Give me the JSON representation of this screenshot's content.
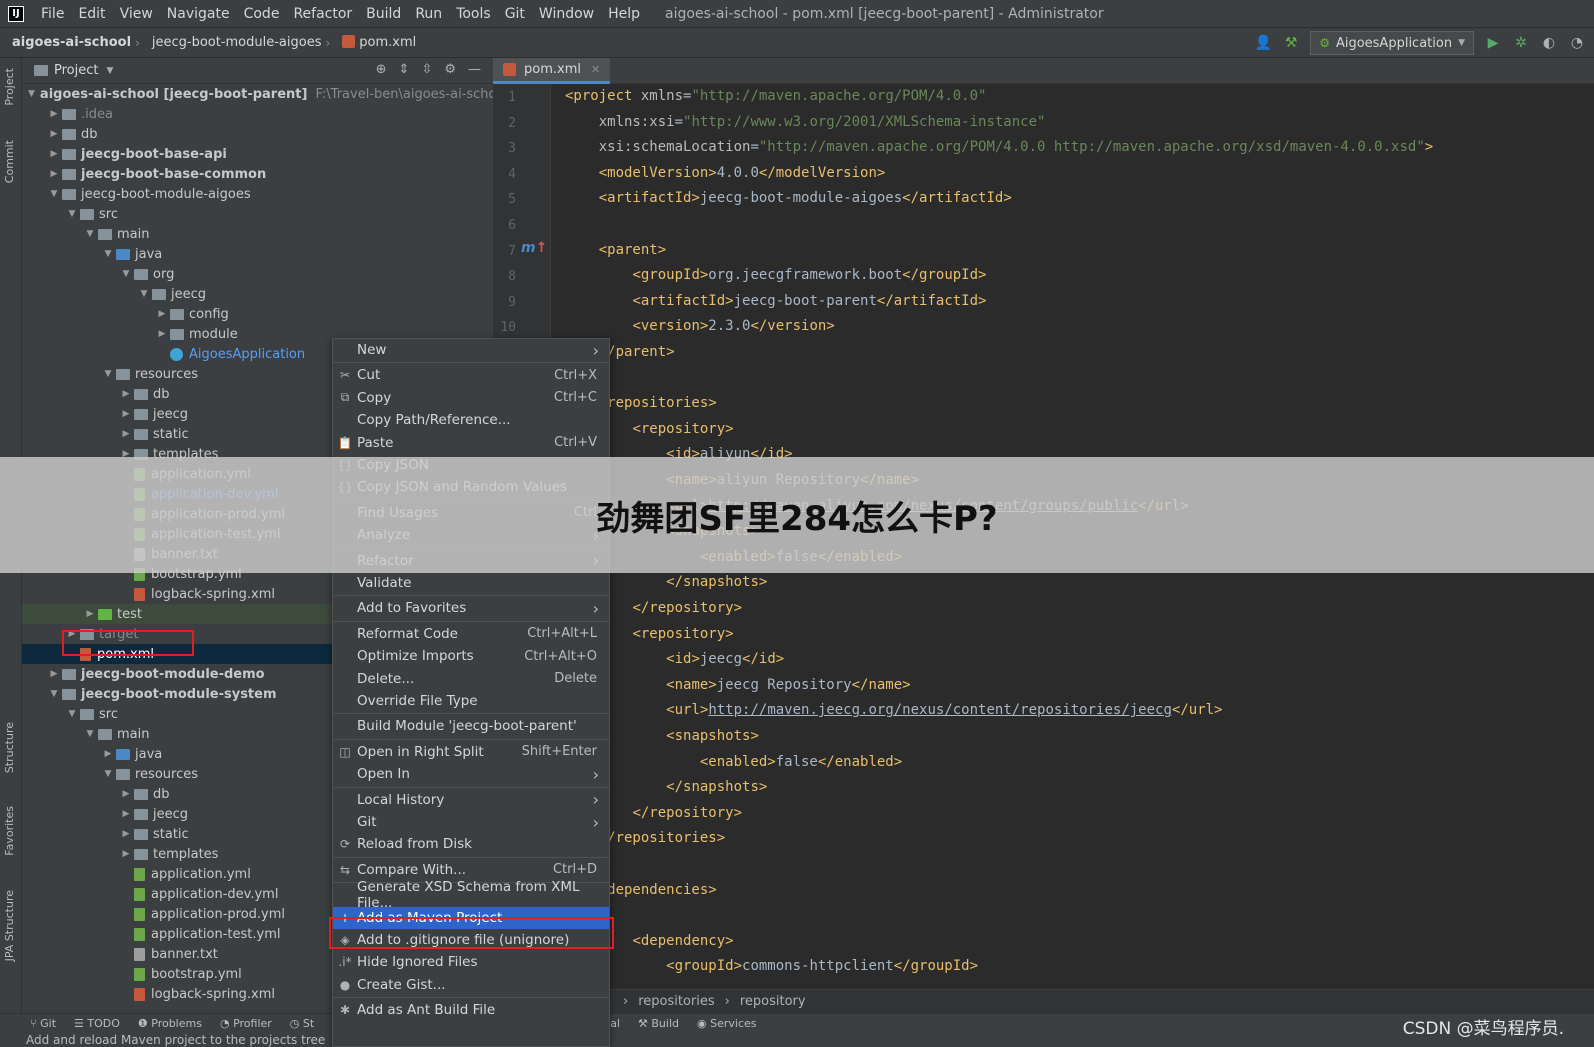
{
  "menubar": {
    "logo": "IJ",
    "items": [
      "File",
      "Edit",
      "View",
      "Navigate",
      "Code",
      "Refactor",
      "Build",
      "Run",
      "Tools",
      "Git",
      "Window",
      "Help"
    ],
    "window_title": "aigoes-ai-school - pom.xml [jeecg-boot-parent] - Administrator"
  },
  "navbar": {
    "crumbs": [
      "aigoes-ai-school",
      "jeecg-boot-module-aigoes",
      "pom.xml"
    ],
    "run_config": "AigoesApplication"
  },
  "left_strip": [
    "Project",
    "Commit",
    "Structure",
    "Favorites",
    "JPA Structure"
  ],
  "project_panel": {
    "title": "Project",
    "tree": [
      {
        "label": "aigoes-ai-school [jeecg-boot-parent]",
        "hint": "F:\\Travel-ben\\aigoes-ai-school",
        "depth": 0,
        "arrow": "open",
        "icon": "module",
        "style": "bold-root"
      },
      {
        "label": ".idea",
        "depth": 1,
        "arrow": "closed",
        "icon": "folder",
        "style": "grey"
      },
      {
        "label": "db",
        "depth": 1,
        "arrow": "closed",
        "icon": "folder",
        "style": ""
      },
      {
        "label": "jeecg-boot-base-api",
        "depth": 1,
        "arrow": "closed",
        "icon": "module",
        "style": "bold"
      },
      {
        "label": "jeecg-boot-base-common",
        "depth": 1,
        "arrow": "closed",
        "icon": "module",
        "style": "bold"
      },
      {
        "label": "jeecg-boot-module-aigoes",
        "depth": 1,
        "arrow": "open",
        "icon": "module",
        "style": ""
      },
      {
        "label": "src",
        "depth": 2,
        "arrow": "open",
        "icon": "folder",
        "style": ""
      },
      {
        "label": "main",
        "depth": 3,
        "arrow": "open",
        "icon": "folder",
        "style": ""
      },
      {
        "label": "java",
        "depth": 4,
        "arrow": "open",
        "icon": "folder-blue",
        "style": ""
      },
      {
        "label": "org",
        "depth": 5,
        "arrow": "open",
        "icon": "folder",
        "style": ""
      },
      {
        "label": "jeecg",
        "depth": 6,
        "arrow": "open",
        "icon": "folder",
        "style": ""
      },
      {
        "label": "config",
        "depth": 7,
        "arrow": "closed",
        "icon": "folder",
        "style": ""
      },
      {
        "label": "module",
        "depth": 7,
        "arrow": "closed",
        "icon": "folder",
        "style": ""
      },
      {
        "label": "AigoesApplication",
        "depth": 7,
        "arrow": "none",
        "icon": "class",
        "style": "blue"
      },
      {
        "label": "resources",
        "depth": 4,
        "arrow": "open",
        "icon": "folder",
        "style": ""
      },
      {
        "label": "db",
        "depth": 5,
        "arrow": "closed",
        "icon": "folder",
        "style": ""
      },
      {
        "label": "jeecg",
        "depth": 5,
        "arrow": "closed",
        "icon": "folder",
        "style": ""
      },
      {
        "label": "static",
        "depth": 5,
        "arrow": "closed",
        "icon": "folder",
        "style": ""
      },
      {
        "label": "templates",
        "depth": 5,
        "arrow": "closed",
        "icon": "folder",
        "style": ""
      },
      {
        "label": "application.yml",
        "depth": 5,
        "arrow": "none",
        "icon": "yml",
        "style": ""
      },
      {
        "label": "application-dev.yml",
        "depth": 5,
        "arrow": "none",
        "icon": "yml",
        "style": "blue"
      },
      {
        "label": "application-prod.yml",
        "depth": 5,
        "arrow": "none",
        "icon": "yml",
        "style": ""
      },
      {
        "label": "application-test.yml",
        "depth": 5,
        "arrow": "none",
        "icon": "yml",
        "style": ""
      },
      {
        "label": "banner.txt",
        "depth": 5,
        "arrow": "none",
        "icon": "txt",
        "style": ""
      },
      {
        "label": "bootstrap.yml",
        "depth": 5,
        "arrow": "none",
        "icon": "yml",
        "style": ""
      },
      {
        "label": "logback-spring.xml",
        "depth": 5,
        "arrow": "none",
        "icon": "xml",
        "style": ""
      },
      {
        "label": "test",
        "depth": 3,
        "arrow": "closed",
        "icon": "folder-green",
        "style": "test"
      },
      {
        "label": "target",
        "depth": 2,
        "arrow": "closed",
        "icon": "folder",
        "style": "grey"
      },
      {
        "label": "pom.xml",
        "depth": 2,
        "arrow": "none",
        "icon": "xml",
        "style": "selected"
      },
      {
        "label": "jeecg-boot-module-demo",
        "depth": 1,
        "arrow": "closed",
        "icon": "module",
        "style": "bold"
      },
      {
        "label": "jeecg-boot-module-system",
        "depth": 1,
        "arrow": "open",
        "icon": "module",
        "style": "bold"
      },
      {
        "label": "src",
        "depth": 2,
        "arrow": "open",
        "icon": "folder",
        "style": ""
      },
      {
        "label": "main",
        "depth": 3,
        "arrow": "open",
        "icon": "folder",
        "style": ""
      },
      {
        "label": "java",
        "depth": 4,
        "arrow": "closed",
        "icon": "folder-blue",
        "style": ""
      },
      {
        "label": "resources",
        "depth": 4,
        "arrow": "open",
        "icon": "folder",
        "style": ""
      },
      {
        "label": "db",
        "depth": 5,
        "arrow": "closed",
        "icon": "folder",
        "style": ""
      },
      {
        "label": "jeecg",
        "depth": 5,
        "arrow": "closed",
        "icon": "folder",
        "style": ""
      },
      {
        "label": "static",
        "depth": 5,
        "arrow": "closed",
        "icon": "folder",
        "style": ""
      },
      {
        "label": "templates",
        "depth": 5,
        "arrow": "closed",
        "icon": "folder",
        "style": ""
      },
      {
        "label": "application.yml",
        "depth": 5,
        "arrow": "none",
        "icon": "yml",
        "style": ""
      },
      {
        "label": "application-dev.yml",
        "depth": 5,
        "arrow": "none",
        "icon": "yml",
        "style": ""
      },
      {
        "label": "application-prod.yml",
        "depth": 5,
        "arrow": "none",
        "icon": "yml",
        "style": ""
      },
      {
        "label": "application-test.yml",
        "depth": 5,
        "arrow": "none",
        "icon": "yml",
        "style": ""
      },
      {
        "label": "banner.txt",
        "depth": 5,
        "arrow": "none",
        "icon": "txt",
        "style": ""
      },
      {
        "label": "bootstrap.yml",
        "depth": 5,
        "arrow": "none",
        "icon": "yml",
        "style": ""
      },
      {
        "label": "logback-spring.xml",
        "depth": 5,
        "arrow": "none",
        "icon": "xml",
        "style": ""
      }
    ]
  },
  "editor": {
    "tab": "pom.xml",
    "line_numbers": [
      "1",
      "2",
      "3",
      "4",
      "5",
      "6",
      "7",
      "8",
      "9",
      "10"
    ],
    "lines": [
      [
        [
          "tag",
          "<project "
        ],
        [
          "attr",
          "xmlns"
        ],
        [
          "txt",
          "="
        ],
        [
          "str",
          "\"http://maven.apache.org/POM/4.0.0\""
        ]
      ],
      [
        [
          "txt",
          "    "
        ],
        [
          "attr",
          "xmlns:xsi"
        ],
        [
          "txt",
          "="
        ],
        [
          "str",
          "\"http://www.w3.org/2001/XMLSchema-instance\""
        ]
      ],
      [
        [
          "txt",
          "    "
        ],
        [
          "attr",
          "xsi:schemaLocation"
        ],
        [
          "txt",
          "="
        ],
        [
          "str",
          "\"http://maven.apache.org/POM/4.0.0 http://maven.apache.org/xsd/maven-4.0.0.xsd\""
        ],
        [
          "tag",
          ">"
        ]
      ],
      [
        [
          "txt",
          "    "
        ],
        [
          "tag",
          "<modelVersion>"
        ],
        [
          "txt",
          "4.0.0"
        ],
        [
          "tag",
          "</modelVersion>"
        ]
      ],
      [
        [
          "txt",
          "    "
        ],
        [
          "tag",
          "<artifactId>"
        ],
        [
          "txt",
          "jeecg-boot-module-aigoes"
        ],
        [
          "tag",
          "</artifactId>"
        ]
      ],
      [
        [
          "txt",
          ""
        ]
      ],
      [
        [
          "txt",
          "    "
        ],
        [
          "tag",
          "<parent>"
        ]
      ],
      [
        [
          "txt",
          "        "
        ],
        [
          "tag",
          "<groupId>"
        ],
        [
          "txt",
          "org.jeecgframework.boot"
        ],
        [
          "tag",
          "</groupId>"
        ]
      ],
      [
        [
          "txt",
          "        "
        ],
        [
          "tag",
          "<artifactId>"
        ],
        [
          "txt",
          "jeecg-boot-parent"
        ],
        [
          "tag",
          "</artifactId>"
        ]
      ],
      [
        [
          "txt",
          "        "
        ],
        [
          "tag",
          "<version>"
        ],
        [
          "txt",
          "2.3.0"
        ],
        [
          "tag",
          "</version>"
        ]
      ],
      [
        [
          "txt",
          "    "
        ],
        [
          "tag",
          "</parent>"
        ]
      ],
      [
        [
          "txt",
          ""
        ]
      ],
      [
        [
          "txt",
          "    "
        ],
        [
          "tag",
          "<repositories>"
        ]
      ],
      [
        [
          "txt",
          "        "
        ],
        [
          "tag",
          "<repository>"
        ]
      ],
      [
        [
          "txt",
          "            "
        ],
        [
          "tag",
          "<id>"
        ],
        [
          "txt",
          "aliyun"
        ],
        [
          "tag",
          "</id>"
        ]
      ],
      [
        [
          "txt",
          "            "
        ],
        [
          "tag",
          "<name>"
        ],
        [
          "txt",
          "aliyun Repository"
        ],
        [
          "tag",
          "</name>"
        ]
      ],
      [
        [
          "txt",
          "            "
        ],
        [
          "tag",
          "<url>"
        ],
        [
          "url",
          "http://maven.aliyun.com/nexus/content/groups/public"
        ],
        [
          "tag",
          "</url>"
        ]
      ],
      [
        [
          "txt",
          "            "
        ],
        [
          "tag",
          "<snapshots>"
        ]
      ],
      [
        [
          "txt",
          "                "
        ],
        [
          "tag",
          "<enabled>"
        ],
        [
          "txt",
          "false"
        ],
        [
          "tag",
          "</enabled>"
        ]
      ],
      [
        [
          "txt",
          "            "
        ],
        [
          "tag",
          "</snapshots>"
        ]
      ],
      [
        [
          "txt",
          "        "
        ],
        [
          "tag",
          "</repository>"
        ]
      ],
      [
        [
          "txt",
          "        "
        ],
        [
          "tag",
          "<repository>"
        ]
      ],
      [
        [
          "txt",
          "            "
        ],
        [
          "tag",
          "<id>"
        ],
        [
          "txt",
          "jeecg"
        ],
        [
          "tag",
          "</id>"
        ]
      ],
      [
        [
          "txt",
          "            "
        ],
        [
          "tag",
          "<name>"
        ],
        [
          "txt",
          "jeecg Repository"
        ],
        [
          "tag",
          "</name>"
        ]
      ],
      [
        [
          "txt",
          "            "
        ],
        [
          "tag",
          "<url>"
        ],
        [
          "url",
          "http://maven.jeecg.org/nexus/content/repositories/jeecg"
        ],
        [
          "tag",
          "</url>"
        ]
      ],
      [
        [
          "txt",
          "            "
        ],
        [
          "tag",
          "<snapshots>"
        ]
      ],
      [
        [
          "txt",
          "                "
        ],
        [
          "tag",
          "<enabled>"
        ],
        [
          "txt",
          "false"
        ],
        [
          "tag",
          "</enabled>"
        ]
      ],
      [
        [
          "txt",
          "            "
        ],
        [
          "tag",
          "</snapshots>"
        ]
      ],
      [
        [
          "txt",
          "        "
        ],
        [
          "tag",
          "</repository>"
        ]
      ],
      [
        [
          "txt",
          "    "
        ],
        [
          "tag",
          "</repositories>"
        ]
      ],
      [
        [
          "txt",
          ""
        ]
      ],
      [
        [
          "txt",
          "    "
        ],
        [
          "tag",
          "<dependencies>"
        ]
      ],
      [
        [
          "txt",
          ""
        ]
      ],
      [
        [
          "txt",
          "        "
        ],
        [
          "tag",
          "<dependency>"
        ]
      ],
      [
        [
          "txt",
          "            "
        ],
        [
          "tag",
          "<groupId>"
        ],
        [
          "txt",
          "commons-httpclient"
        ],
        [
          "tag",
          "</groupId>"
        ]
      ]
    ],
    "breadcrumb": [
      "repositories",
      "repository"
    ]
  },
  "context_menu": {
    "items": [
      {
        "label": "New",
        "shortcut": "",
        "submenu": true,
        "icon": ""
      },
      {
        "sep": true
      },
      {
        "label": "Cut",
        "shortcut": "Ctrl+X",
        "icon": "✂"
      },
      {
        "label": "Copy",
        "shortcut": "Ctrl+C",
        "icon": "⧉"
      },
      {
        "label": "Copy Path/Reference...",
        "shortcut": "",
        "icon": ""
      },
      {
        "label": "Paste",
        "shortcut": "Ctrl+V",
        "icon": "📋"
      },
      {
        "label": "Copy JSON",
        "shortcut": "",
        "icon": "{}"
      },
      {
        "label": "Copy JSON and Random Values",
        "shortcut": "",
        "icon": "{}"
      },
      {
        "sep": true
      },
      {
        "label": "Find Usages",
        "shortcut": "Ctrl",
        "icon": ""
      },
      {
        "label": "Analyze",
        "shortcut": "",
        "submenu": true,
        "icon": ""
      },
      {
        "sep": true
      },
      {
        "label": "Refactor",
        "shortcut": "",
        "submenu": true,
        "icon": ""
      },
      {
        "label": "Validate",
        "shortcut": "",
        "icon": ""
      },
      {
        "sep": true
      },
      {
        "label": "Add to Favorites",
        "shortcut": "",
        "submenu": true,
        "icon": ""
      },
      {
        "sep": true
      },
      {
        "label": "Reformat Code",
        "shortcut": "Ctrl+Alt+L",
        "icon": ""
      },
      {
        "label": "Optimize Imports",
        "shortcut": "Ctrl+Alt+O",
        "icon": ""
      },
      {
        "label": "Delete...",
        "shortcut": "Delete",
        "icon": ""
      },
      {
        "label": "Override File Type",
        "shortcut": "",
        "icon": ""
      },
      {
        "sep": true
      },
      {
        "label": "Build Module 'jeecg-boot-parent'",
        "shortcut": "",
        "icon": ""
      },
      {
        "sep": true
      },
      {
        "label": "Open in Right Split",
        "shortcut": "Shift+Enter",
        "icon": "◫"
      },
      {
        "label": "Open In",
        "shortcut": "",
        "submenu": true,
        "icon": ""
      },
      {
        "sep": true
      },
      {
        "label": "Local History",
        "shortcut": "",
        "submenu": true,
        "icon": ""
      },
      {
        "label": "Git",
        "shortcut": "",
        "submenu": true,
        "icon": ""
      },
      {
        "label": "Reload from Disk",
        "shortcut": "",
        "icon": "⟳"
      },
      {
        "sep": true
      },
      {
        "label": "Compare With...",
        "shortcut": "Ctrl+D",
        "icon": "⇆"
      },
      {
        "sep": true
      },
      {
        "label": "Generate XSD Schema from XML File...",
        "shortcut": "",
        "icon": ""
      },
      {
        "label": "Add as Maven Project",
        "shortcut": "",
        "icon": "+",
        "active": true
      },
      {
        "label": "Add to .gitignore file (unignore)",
        "shortcut": "",
        "icon": "◈"
      },
      {
        "label": "Hide Ignored Files",
        "shortcut": "",
        "icon": ".i*"
      },
      {
        "label": "Create Gist...",
        "shortcut": "",
        "icon": "●"
      },
      {
        "sep": true
      },
      {
        "label": "Add as Ant Build File",
        "shortcut": "",
        "icon": "✱"
      }
    ]
  },
  "bottom_tabs": [
    "Git",
    "TODO",
    "Problems",
    "Profiler",
    "St",
    "inal",
    "Build",
    "Services"
  ],
  "statusbar": {
    "text": "Add and reload Maven project to the projects tree"
  },
  "banner": {
    "text": "劲舞团SF里284怎么卡P?"
  },
  "watermark": "CSDN @菜鸟程序员."
}
